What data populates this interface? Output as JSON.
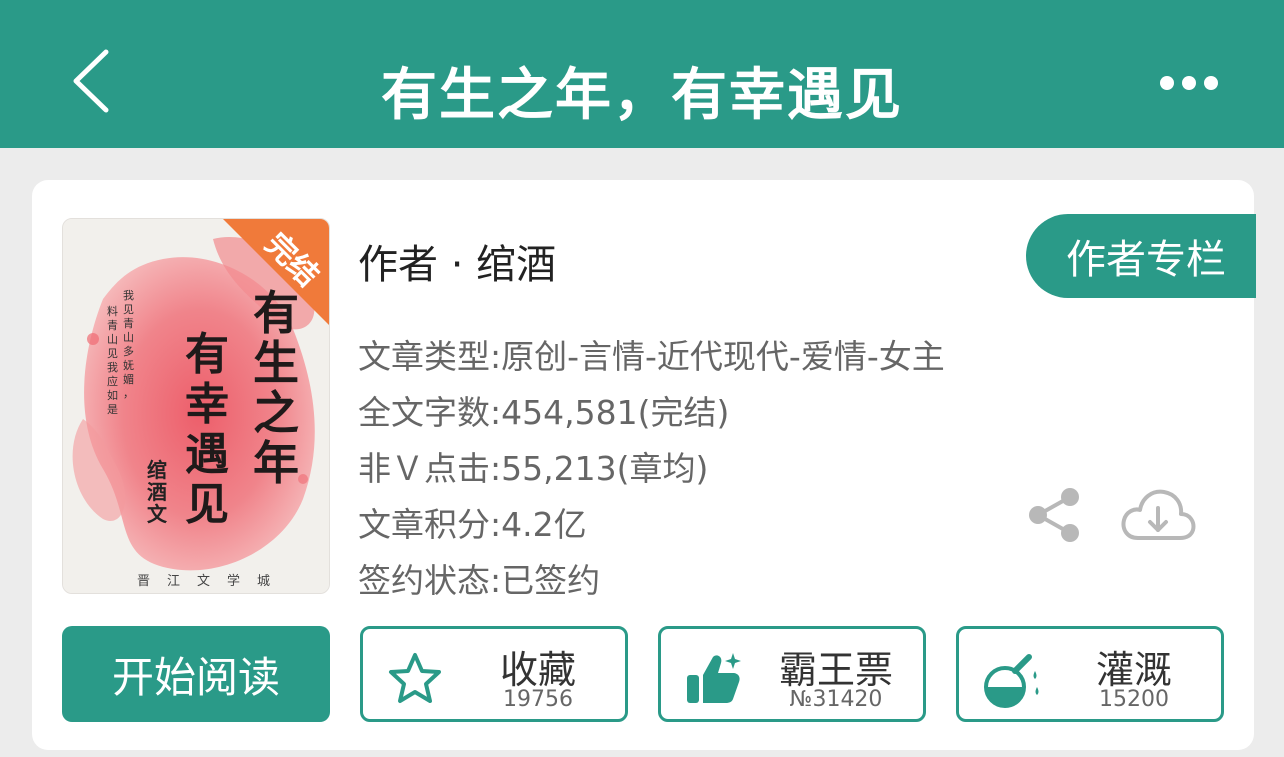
{
  "header": {
    "title": "有生之年，有幸遇见"
  },
  "book": {
    "author_line": "作者 · 绾酒",
    "column_label": "作者专栏",
    "status_badge": "完结",
    "cover_text": {
      "title_col1": "有生之年",
      "title_col2": "有幸遇见",
      "author": "绾酒文",
      "publisher": "晋江文学城",
      "poem_col1": "我见青山多妩媚，",
      "poem_col2": "料青山见我应如是。"
    },
    "meta": [
      "文章类型:原创-言情-近代现代-爱情-女主",
      "全文字数:454,581(完结)",
      "非Ｖ点击:55,213(章均)",
      "文章积分:4.2亿",
      "签约状态:已签约"
    ]
  },
  "actions": {
    "read_label": "开始阅读",
    "favorite": {
      "label": "收藏",
      "count": "19756"
    },
    "vote": {
      "label": "霸王票",
      "count": "№31420"
    },
    "water": {
      "label": "灌溉",
      "count": "15200"
    }
  },
  "colors": {
    "brand": "#2a9a88",
    "badge": "#f07a3a"
  }
}
